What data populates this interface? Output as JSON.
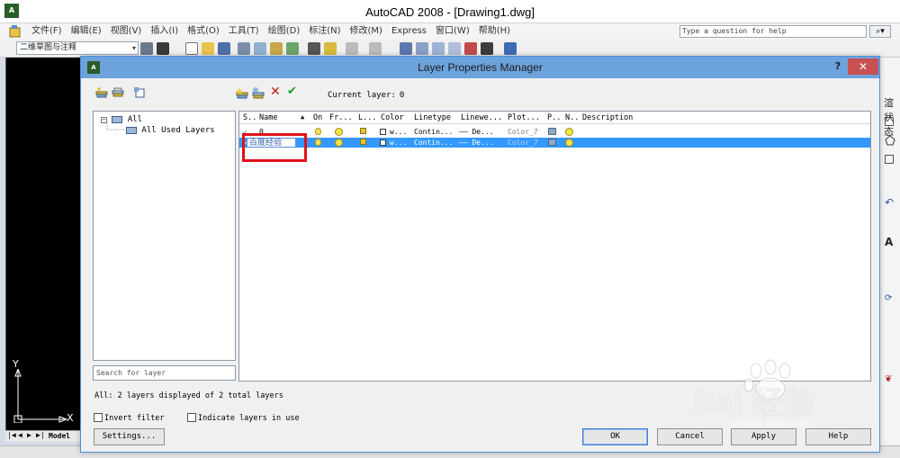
{
  "app": {
    "title": "AutoCAD 2008 - [Drawing1.dwg]",
    "menu": [
      "文件(F)",
      "编辑(E)",
      "视图(V)",
      "插入(I)",
      "格式(O)",
      "工具(T)",
      "绘图(D)",
      "标注(N)",
      "修改(M)",
      "Express",
      "窗口(W)",
      "帮助(H)"
    ],
    "help_placeholder": "Type a question for help",
    "workspace": "二维草图与注释",
    "model_tab": "Model",
    "ucs_x": "X",
    "ucs_y": "Y",
    "right_label": "渲状态"
  },
  "dialog": {
    "title": "Layer Properties Manager",
    "help_glyph": "?",
    "close_glyph": "✕",
    "current_layer_label": "Current layer:",
    "current_layer_value": "0",
    "tree": {
      "root": "All",
      "child": "All Used Layers"
    },
    "search_placeholder": "Search for layer",
    "columns": [
      "S..",
      "Name",
      "On",
      "Fr...",
      "L...",
      "Color",
      "Linetype",
      "Linewe...",
      "Plot...",
      "P..",
      "N..",
      "Description"
    ],
    "layers": [
      {
        "status": "✓",
        "name": "0",
        "color": "w...",
        "linetype": "Contin...",
        "lineweight": "—— De...",
        "plot_style": "Color_7",
        "selected": false
      },
      {
        "status": "▱",
        "name": "百度经验",
        "color": "w...",
        "linetype": "Contin...",
        "lineweight": "—— De...",
        "plot_style": "Color_7",
        "selected": true
      }
    ],
    "status_text": "All: 2 layers displayed of 2 total layers",
    "invert_filter": "Invert filter",
    "indicate_layers": "Indicate layers in use",
    "buttons": {
      "settings": "Settings...",
      "ok": "OK",
      "cancel": "Cancel",
      "apply": "Apply",
      "help": "Help"
    }
  },
  "watermark": {
    "brand": "Bai  经验",
    "url": "jingyan.baidu.com"
  },
  "colors": {
    "dialog_title_bg": "#6da3dc",
    "selection": "#3399ff",
    "highlight_box": "#e0121a",
    "close_button": "#c75050"
  }
}
